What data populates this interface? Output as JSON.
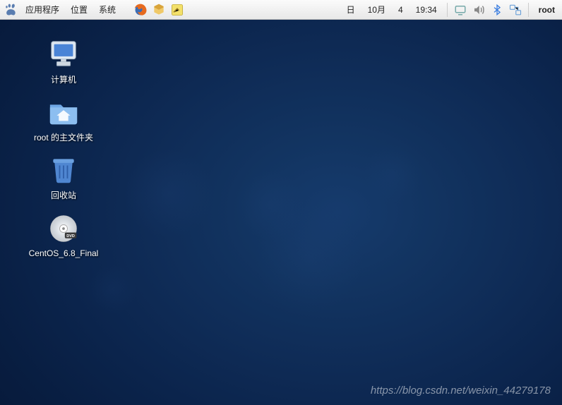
{
  "panel": {
    "menus": {
      "applications": "应用程序",
      "places": "位置",
      "system": "系统"
    },
    "datetime": {
      "weekday": "日",
      "month": "10月",
      "day": "4",
      "time": "19:34"
    },
    "user": "root",
    "launchers": {
      "firefox": "firefox-icon",
      "help": "help-icon",
      "editor": "text-editor-icon"
    },
    "tray": {
      "display": "display-icon",
      "volume": "volume-icon",
      "bluetooth": "bluetooth-icon",
      "network": "network-icon"
    }
  },
  "desktop_icons": {
    "computer": {
      "label": "计算机"
    },
    "home": {
      "label": "root 的主文件夹"
    },
    "trash": {
      "label": "回收站"
    },
    "disc": {
      "label": "CentOS_6.8_Final"
    }
  },
  "watermark": "https://blog.csdn.net/weixin_44279178"
}
